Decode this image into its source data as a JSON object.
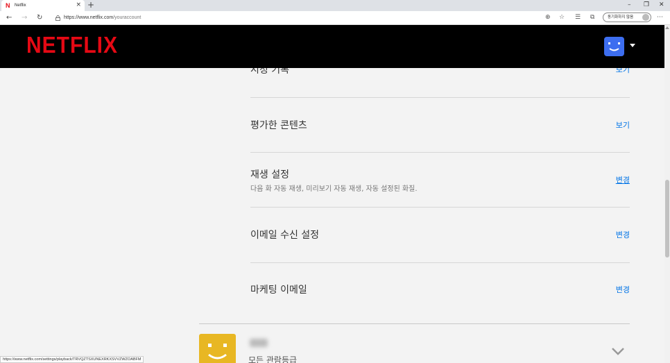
{
  "browser": {
    "tab_title": "Netflix",
    "tab_favicon": "N",
    "new_tab_icon": "+",
    "url_host": "https://www.netflix.com",
    "url_path": "/youraccount",
    "profile_pill": "동기화하지 않음",
    "window_controls": {
      "minimize": "–",
      "restore": "❐",
      "close": "✕"
    },
    "status_url": "https://www.netflix.com/settings/playback/TRVQZTSXUNEXRKXSVVZWZOABFM"
  },
  "header": {
    "logo": "NETFLIX"
  },
  "settings": {
    "rows": [
      {
        "title": "시청 기록",
        "action": "보기"
      },
      {
        "title": "평가한 콘텐츠",
        "action": "보기"
      },
      {
        "title": "재생 설정",
        "desc": "다음 화 자동 재생, 미리보기 자동 재생, 자동 설정된 화질.",
        "action": "변경"
      },
      {
        "title": "이메일 수신 설정",
        "action": "변경"
      },
      {
        "title": "마케팅 이메일",
        "action": "변경"
      }
    ]
  },
  "profile": {
    "rating": "모든 관람등급"
  },
  "colors": {
    "netflix_red": "#e50914",
    "link_blue": "#0073e6",
    "avatar_blue": "#3d6ef0",
    "avatar_yellow": "#e8b723"
  }
}
